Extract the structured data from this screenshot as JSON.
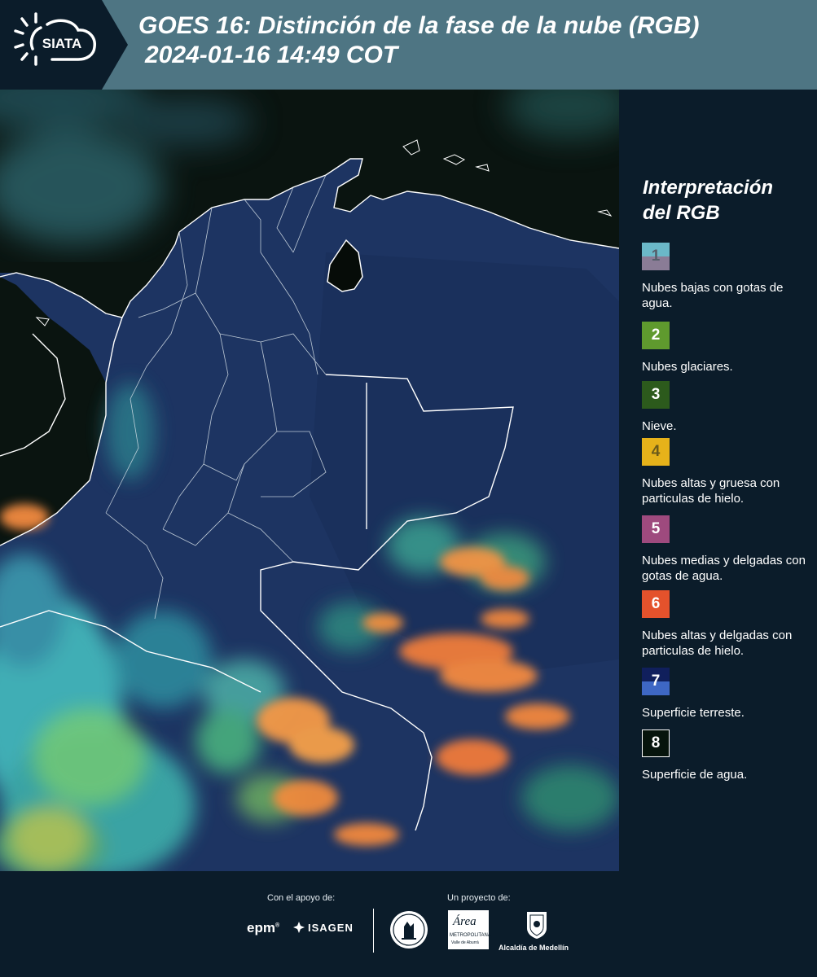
{
  "header": {
    "logo_text": "SIATA",
    "title_line1": "GOES 16: Distinción de la fase de la nube (RGB)",
    "title_line2": "2024-01-16 14:49 COT"
  },
  "legend": {
    "title_line1": "Interpretación",
    "title_line2": "del RGB",
    "items": [
      {
        "number": "1",
        "label": "Nubes bajas con gotas de agua.",
        "color_top": "#6bb8c8",
        "color_bottom": "#8a7c96"
      },
      {
        "number": "2",
        "label": "Nubes glaciares.",
        "color_top": "#5f9a2e",
        "color_bottom": "#5f9a2e"
      },
      {
        "number": "3",
        "label": "Nieve.",
        "color_top": "#2c5a1c",
        "color_bottom": "#2c5a1c"
      },
      {
        "number": "4",
        "label": "Nubes altas y gruesa con particulas de hielo.",
        "color_top": "#e6b21a",
        "color_bottom": "#e6b21a"
      },
      {
        "number": "5",
        "label": "Nubes medias y delgadas con gotas de agua.",
        "color_top": "#9e4a7e",
        "color_bottom": "#9e4a7e"
      },
      {
        "number": "6",
        "label": "Nubes altas y delgadas con particulas de hielo.",
        "color_top": "#e4522c",
        "color_bottom": "#e4522c"
      },
      {
        "number": "7",
        "label": "Superficie terreste.",
        "color_top": "#101f5c",
        "color_bottom": "#3e67c4"
      },
      {
        "number": "8",
        "label": "Superficie de agua.",
        "color_top": "#06140c",
        "color_bottom": "#06140c"
      }
    ]
  },
  "footer": {
    "support_label": "Con el apoyo de:",
    "project_label": "Un proyecto de:",
    "sponsor1": "epm",
    "sponsor2": "ISAGEN",
    "partner1_line1": "Área",
    "partner1_line2": "METROPOLITANA",
    "partner1_line3": "Valle de Aburrá",
    "partner2": "Alcaldía de Medellín"
  },
  "colors": {
    "header_bg": "#4e7583",
    "page_bg": "#0b1c2a",
    "land": "#1e3560",
    "ocean": "#080f0b",
    "cloud_cyan": "#3fbcc4",
    "cloud_orange": "#f28a3c"
  }
}
